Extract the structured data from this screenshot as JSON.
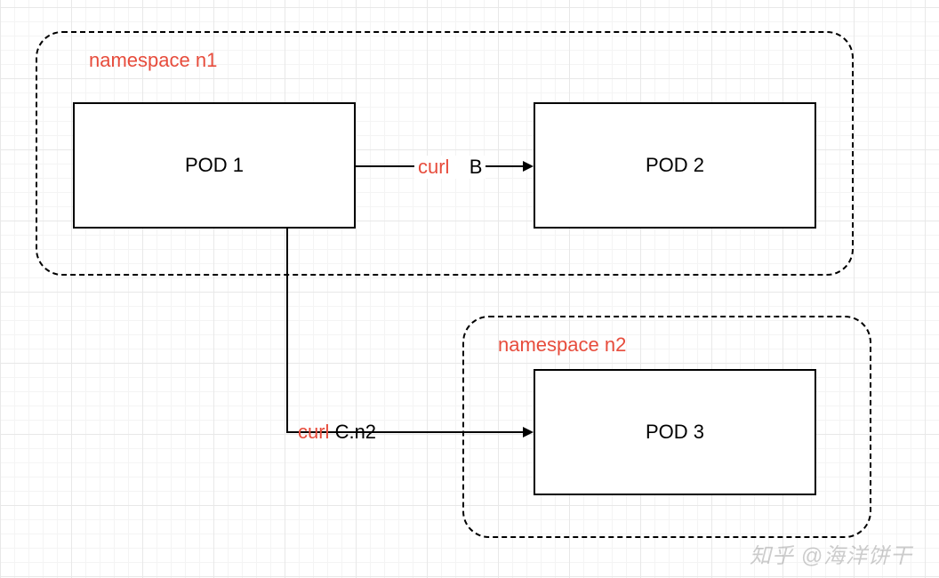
{
  "namespaces": {
    "n1": {
      "label": "namespace n1"
    },
    "n2": {
      "label": "namespace n2"
    }
  },
  "pods": {
    "pod1": "POD 1",
    "pod2": "POD 2",
    "pod3": "POD 3"
  },
  "arrows": {
    "pod1_to_pod2": {
      "label_curl": "curl",
      "label_target": "B"
    },
    "pod1_to_pod3": {
      "label_curl": "curl",
      "label_target": " C.n2"
    }
  },
  "watermark": "知乎 @海洋饼干"
}
